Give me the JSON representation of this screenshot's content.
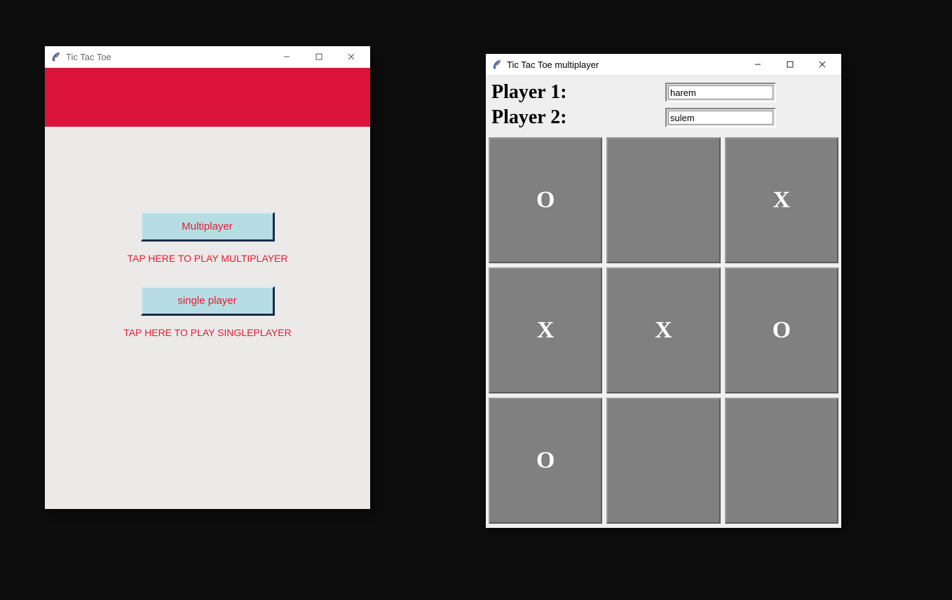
{
  "menu_window": {
    "title": "Tic Tac Toe",
    "buttons": {
      "multiplayer_label": "Multiplayer",
      "singleplayer_label": "single player"
    },
    "hints": {
      "multiplayer": "TAP HERE TO PLAY MULTIPLAYER",
      "singleplayer": "TAP HERE TO PLAY SINGLEPLAYER"
    },
    "colors": {
      "banner": "#dc143c",
      "button_bg": "#b7dde4",
      "button_fg": "#e11d2f"
    }
  },
  "game_window": {
    "title": "Tic Tac Toe multiplayer",
    "players": {
      "label1": "Player 1:",
      "label2": "Player 2:",
      "name1": "harem",
      "name2": "sulem"
    },
    "board": {
      "cells": [
        "O",
        "",
        "X",
        "X",
        "X",
        "O",
        "O",
        "",
        ""
      ]
    }
  },
  "win_controls": {
    "minimize": "minimize",
    "maximize": "maximize",
    "close": "close"
  }
}
